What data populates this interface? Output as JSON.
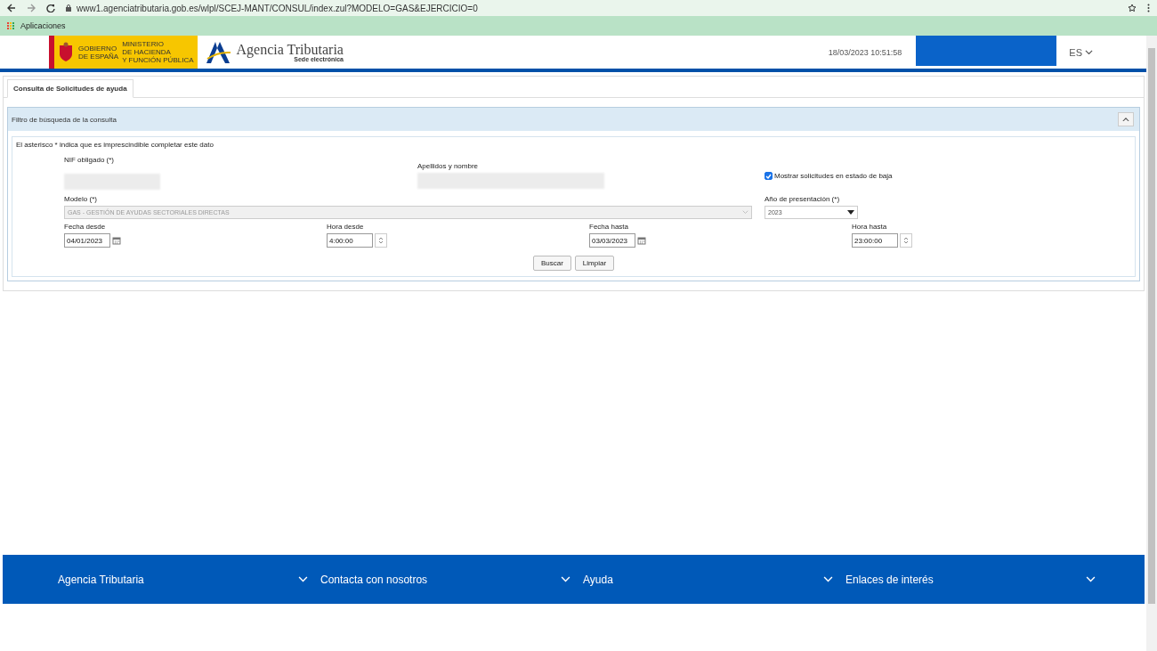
{
  "browser": {
    "url": "www1.agenciatributaria.gob.es/wlpl/SCEJ-MANT/CONSUL/index.zul?MODELO=GAS&EJERCICIO=0",
    "bookmarks": [
      "Aplicaciones"
    ]
  },
  "header": {
    "gov_lines": [
      "GOBIERNO",
      "DE ESPAÑA"
    ],
    "ministry_lines": [
      "MINISTERIO",
      "DE HACIENDA",
      "Y FUNCIÓN PÚBLICA"
    ],
    "brand": "Agencia Tributaria",
    "brand_sub": "Sede electrónica",
    "datetime": "18/03/2023 10:51:58",
    "language": "ES"
  },
  "tabs": [
    {
      "label": "Consulta de Solicitudes de ayuda",
      "selected": true
    }
  ],
  "filter": {
    "title": "Filtro de búsqueda de la consulta",
    "expanded": true,
    "note": "El asterisco * indica que es imprescindible completar este dato",
    "identity_fields": [
      {
        "kind": "text",
        "label": "NIF obligado (*)"
      },
      {
        "kind": "text",
        "label": "Apellidos y nombre"
      },
      {
        "kind": "checkbox",
        "label": "Mostrar solicitudes en estado de baja",
        "checked": true
      }
    ],
    "model_fields": [
      {
        "kind": "select",
        "label": "Modelo (*)",
        "value": "GAS - GESTIÓN DE AYUDAS SECTORIALES DIRECTAS",
        "disabled": true
      },
      {
        "kind": "select",
        "label": "Año de presentación (*)",
        "value": "2023",
        "disabled": false
      }
    ],
    "range_fields": [
      {
        "kind": "date",
        "label": "Fecha desde",
        "value": "04/01/2023"
      },
      {
        "kind": "time",
        "label": "Hora desde",
        "value": "4:00:00"
      },
      {
        "kind": "date",
        "label": "Fecha hasta",
        "value": "03/03/2023"
      },
      {
        "kind": "time",
        "label": "Hora hasta",
        "value": "23:00:00"
      }
    ],
    "buttons": [
      "Buscar",
      "Limpiar"
    ]
  },
  "footer": [
    "Agencia Tributaria",
    "Contacta con nosotros",
    "Ayuda",
    "Enlaces de interés"
  ]
}
